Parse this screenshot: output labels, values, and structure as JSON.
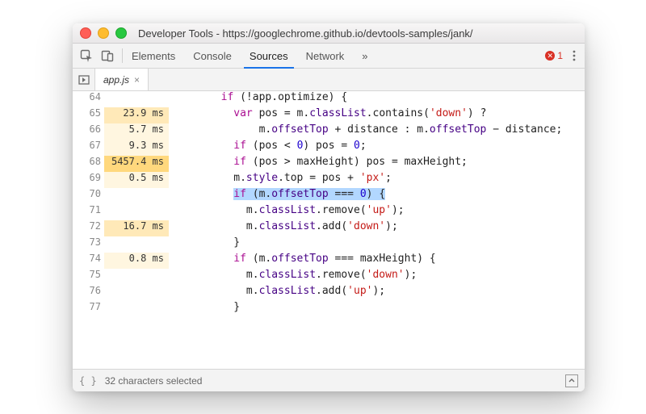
{
  "window": {
    "title": "Developer Tools - https://googlechrome.github.io/devtools-samples/jank/"
  },
  "tabs": {
    "items": [
      "Elements",
      "Console",
      "Sources",
      "Network"
    ],
    "activeIndex": 2,
    "overflow": "»",
    "errorCount": "1"
  },
  "fileTab": {
    "label": "app.js",
    "close": "×"
  },
  "status": {
    "text": "32 characters selected"
  },
  "code": {
    "selectedLine": 70,
    "lines": [
      {
        "n": 64,
        "timing": "",
        "heat": "",
        "indent": 8,
        "html": "<span class='kw'>if</span> (!app.optimize) {"
      },
      {
        "n": 65,
        "timing": "23.9 ms",
        "heat": "t1",
        "indent": 10,
        "html": "<span class='kw'>var</span> pos = m.<span class='prop'>classList</span>.contains(<span class='str'>'down'</span>) ?"
      },
      {
        "n": 66,
        "timing": "5.7 ms",
        "heat": "t0",
        "indent": 14,
        "html": "m.<span class='prop'>offsetTop</span> + distance : m.<span class='prop'>offsetTop</span> &minus; distance;"
      },
      {
        "n": 67,
        "timing": "9.3 ms",
        "heat": "t0",
        "indent": 10,
        "html": "<span class='kw'>if</span> (pos &lt; <span class='num'>0</span>) pos = <span class='num'>0</span>;"
      },
      {
        "n": 68,
        "timing": "5457.4 ms",
        "heat": "t3",
        "indent": 10,
        "html": "<span class='kw'>if</span> (pos &gt; maxHeight) pos = maxHeight;"
      },
      {
        "n": 69,
        "timing": "0.5 ms",
        "heat": "t0",
        "indent": 10,
        "html": "m.<span class='prop'>style</span>.top = pos + <span class='str'>'px'</span>;"
      },
      {
        "n": 70,
        "timing": "",
        "heat": "",
        "indent": 10,
        "html": "<span class='sel'><span class='kw'>if</span> (m.<span class='prop'>offsetTop</span> === <span class='num'>0</span>) {</span>"
      },
      {
        "n": 71,
        "timing": "",
        "heat": "",
        "indent": 12,
        "html": "m.<span class='prop'>classList</span>.remove(<span class='str'>'up'</span>);"
      },
      {
        "n": 72,
        "timing": "16.7 ms",
        "heat": "t1",
        "indent": 12,
        "html": "m.<span class='prop'>classList</span>.add(<span class='str'>'down'</span>);"
      },
      {
        "n": 73,
        "timing": "",
        "heat": "",
        "indent": 10,
        "html": "}"
      },
      {
        "n": 74,
        "timing": "0.8 ms",
        "heat": "t0",
        "indent": 10,
        "html": "<span class='kw'>if</span> (m.<span class='prop'>offsetTop</span> === maxHeight) {"
      },
      {
        "n": 75,
        "timing": "",
        "heat": "",
        "indent": 12,
        "html": "m.<span class='prop'>classList</span>.remove(<span class='str'>'down'</span>);"
      },
      {
        "n": 76,
        "timing": "",
        "heat": "",
        "indent": 12,
        "html": "m.<span class='prop'>classList</span>.add(<span class='str'>'up'</span>);"
      },
      {
        "n": 77,
        "timing": "",
        "heat": "",
        "indent": 10,
        "html": "}"
      }
    ]
  }
}
